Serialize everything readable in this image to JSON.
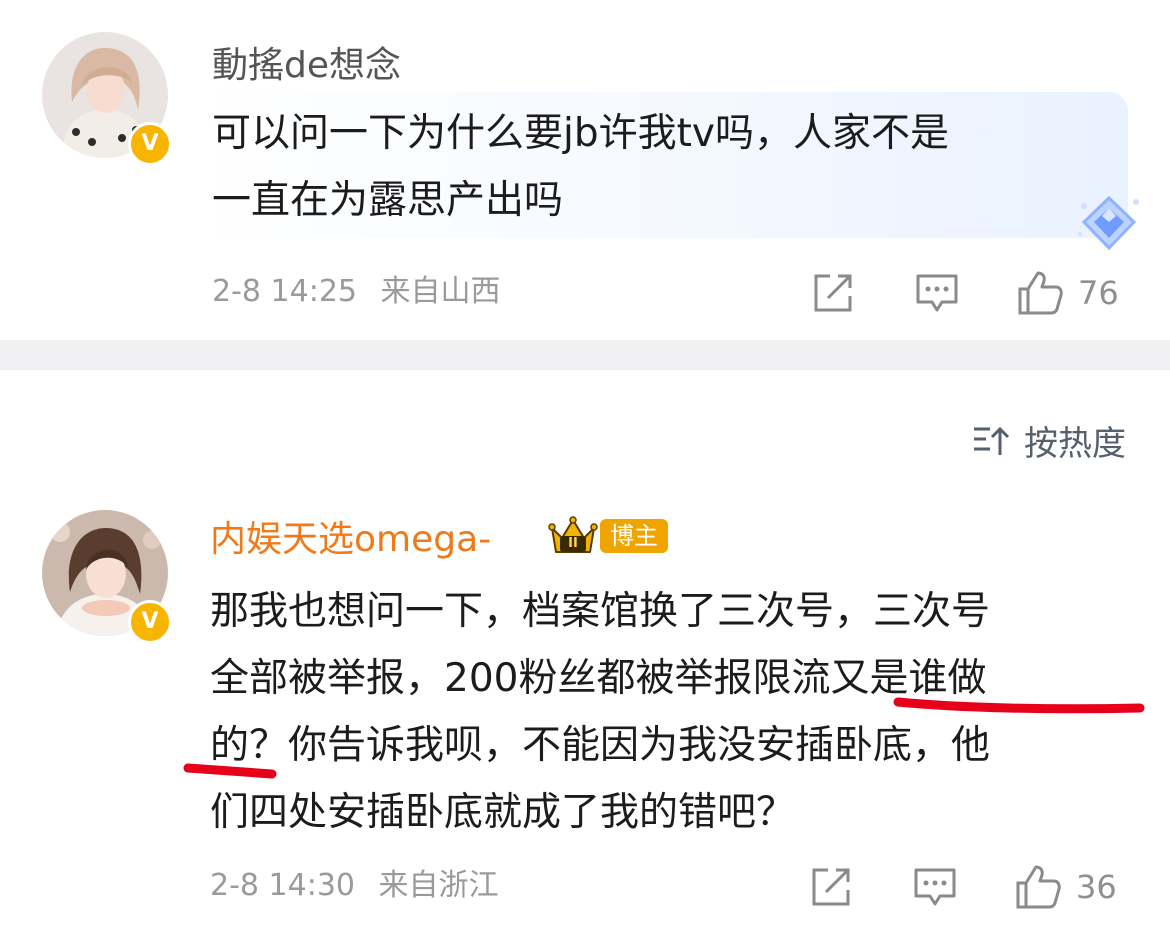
{
  "comments": [
    {
      "username": "動搖de想念",
      "verified_badge": "V",
      "content_lines": [
        "可以问一下为什么要jb许我tv吗，人家不是",
        "一直在为露思产出吗"
      ],
      "date": "2-8 14:25",
      "location": "来自山西",
      "like_count": "76",
      "name_color": "#555555"
    },
    {
      "username": "内娱天选omega-",
      "verified_badge": "V",
      "rank_badge": "II",
      "role_badge": "博主",
      "content_lines": [
        "那我也想问一下，档案馆换了三次号，三次号",
        "全部被举报，200粉丝都被举报限流又是谁做",
        "的？你告诉我呗，不能因为我没安插卧底，他",
        "们四处安插卧底就成了我的错吧？"
      ],
      "date": "2-8 14:30",
      "location": "来自浙江",
      "like_count": "36",
      "name_color": "#f07a1a"
    }
  ],
  "sort": {
    "label": "按热度",
    "icon": "sort-icon"
  },
  "icons": {
    "share": "share-icon",
    "comment": "comment-icon",
    "like": "thumbs-up-icon",
    "diamond": "diamond-sticker-icon",
    "crown": "crown-icon"
  },
  "colors": {
    "verified": "#f7b500",
    "annotation": "#e6001a",
    "accent_orange": "#f07a1a",
    "divider": "#f0f0f2"
  }
}
